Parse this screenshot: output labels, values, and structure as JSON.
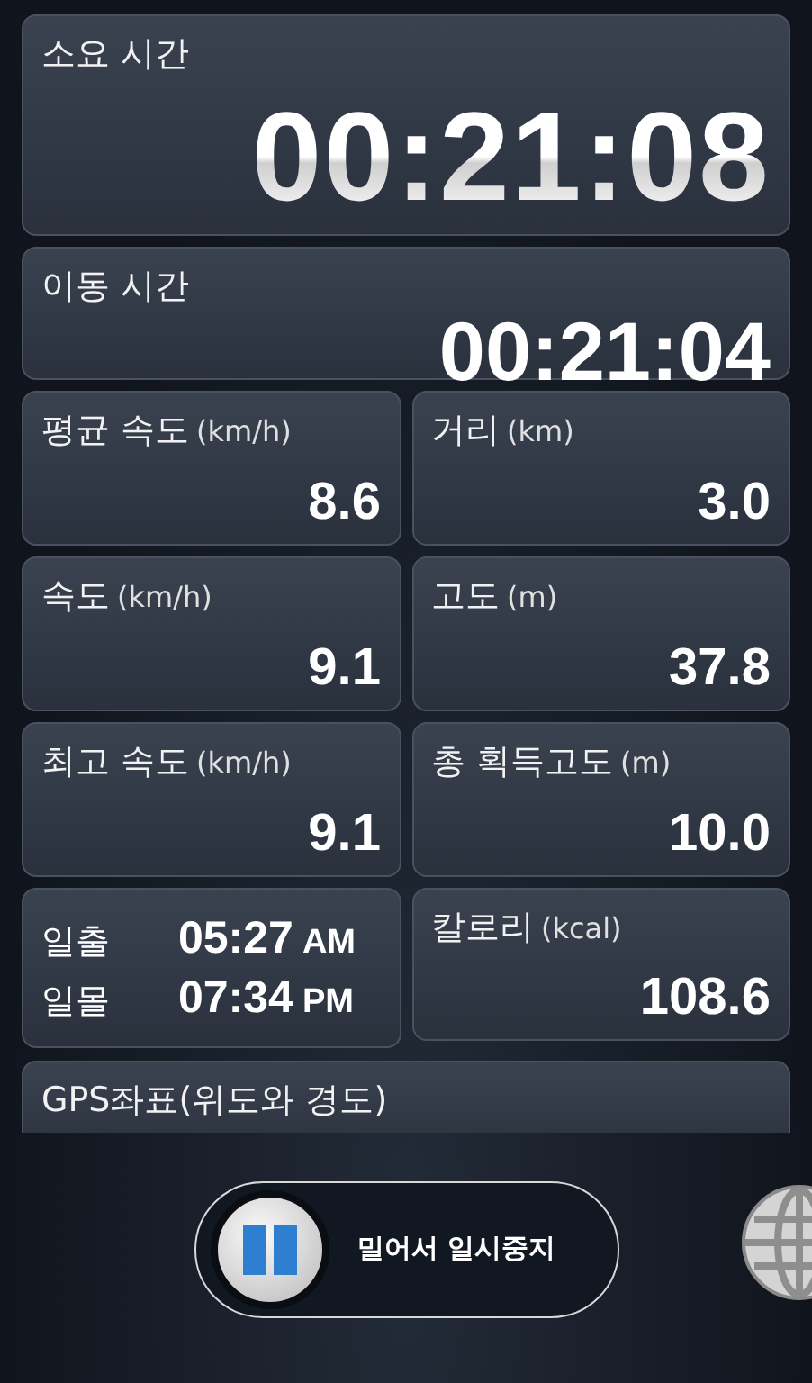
{
  "total_time": {
    "label": "소요 시간",
    "value": "00:21:08"
  },
  "moving_time": {
    "label": "이동 시간",
    "value": "00:21:04"
  },
  "stats": [
    {
      "label": "평균 속도",
      "unit": "(km/h)",
      "value": "8.6"
    },
    {
      "label": "거리",
      "unit": "(km)",
      "value": "3.0"
    },
    {
      "label": "속도",
      "unit": "(km/h)",
      "value": "9.1"
    },
    {
      "label": "고도",
      "unit": "(m)",
      "value": "37.8"
    },
    {
      "label": "최고 속도",
      "unit": "(km/h)",
      "value": "9.1"
    },
    {
      "label": "총 획득고도",
      "unit": "(m)",
      "value": "10.0"
    }
  ],
  "sun": [
    {
      "label": "일출",
      "time": "05:27",
      "period": "AM"
    },
    {
      "label": "일몰",
      "time": "07:34",
      "period": "PM"
    }
  ],
  "calories": {
    "label": "칼로리",
    "unit": "(kcal)",
    "value": "108.6"
  },
  "gps": {
    "label": "GPS좌표(위도와 경도)"
  },
  "slider": {
    "label": "밀어서 일시중지"
  }
}
